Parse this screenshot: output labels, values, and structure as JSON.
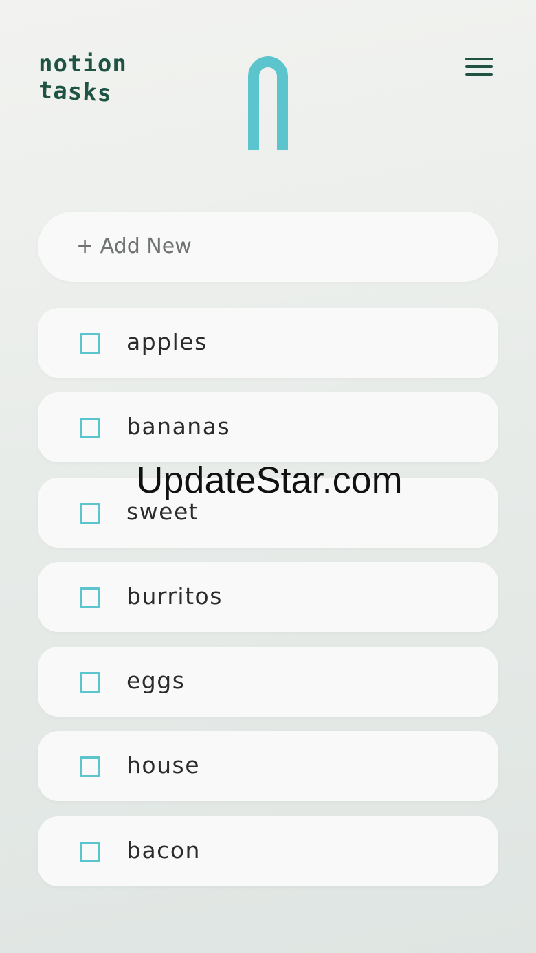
{
  "header": {
    "logo_line1": "notion",
    "logo_line2": "tasks",
    "center_icon": "arch-icon",
    "menu_icon": "hamburger-menu-icon"
  },
  "add_new": {
    "label": "+ Add New"
  },
  "tasks": [
    {
      "label": "apples",
      "checked": false
    },
    {
      "label": "bananas",
      "checked": false
    },
    {
      "label": "sweet",
      "checked": false
    },
    {
      "label": "burritos",
      "checked": false
    },
    {
      "label": "eggs",
      "checked": false
    },
    {
      "label": "house",
      "checked": false
    },
    {
      "label": "bacon",
      "checked": false
    }
  ],
  "watermark": "UpdateStar.com",
  "colors": {
    "brand_dark": "#1f5444",
    "accent": "#5cc4cc",
    "card": "#f8f9f8",
    "text": "#2b2b2b",
    "placeholder": "#6f7370"
  }
}
